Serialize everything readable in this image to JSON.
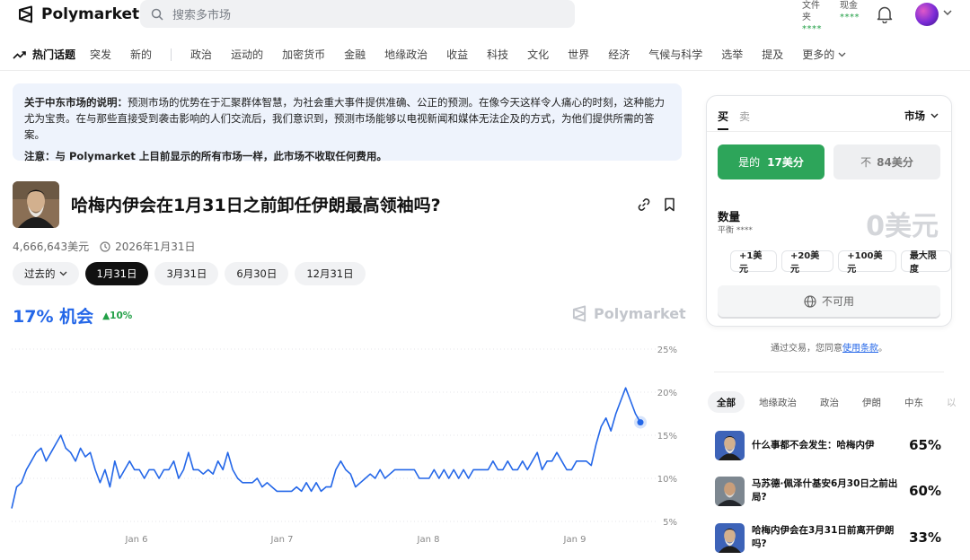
{
  "header": {
    "logo_text": "Polymarket",
    "search_placeholder": "搜索多市场",
    "portfolio_label": "文件夹",
    "portfolio_value": "****",
    "cash_label": "现金",
    "cash_value": "****"
  },
  "nav": {
    "hot": "热门话题",
    "items_a": [
      "突发",
      "新的"
    ],
    "items_b": [
      "政治",
      "运动的",
      "加密货币",
      "金融",
      "地缘政治",
      "收益",
      "科技",
      "文化",
      "世界",
      "经济",
      "气候与科学",
      "选举",
      "提及"
    ],
    "more": "更多的"
  },
  "notice": {
    "line1_bold": "关于中东市场的说明：",
    "line1": "预测市场的优势在于汇聚群体智慧，为社会重大事件提供准确、公正的预测。在像今天这样令人痛心的时刻，这种能力尤为宝贵。在与那些直接受到袭击影响的人们交流后，我们意识到，预测市场能够以电视新闻和媒体无法企及的方式，为他们提供所需的答案。",
    "line2_bold": "注意：",
    "line2": "与 Polymarket 上目前显示的所有市场一样，此市场不收取任何费用。"
  },
  "market": {
    "title": "哈梅内伊会在1月31日之前卸任伊朗最高领袖吗?",
    "volume": "4,666,643美元",
    "end_date": "2026年1月31日",
    "pills": [
      "过去的",
      "1月31日",
      "3月31日",
      "6月30日",
      "12月31日"
    ],
    "chance": "17% 机会",
    "delta": "▲10%",
    "watermark": "Polymarket"
  },
  "trade": {
    "tab_buy": "买",
    "tab_sell": "卖",
    "order_type": "市场",
    "yes_label": "是的",
    "yes_price": "17美分",
    "no_label": "不",
    "no_price": "84美分",
    "qty_label": "数量",
    "balance": "平衡 ****",
    "qty_value": "0美元",
    "quick": [
      "+1美元",
      "+20美元",
      "+100美元",
      "最大限度"
    ],
    "unavailable": "不可用",
    "terms_prefix": "通过交易，您同意",
    "terms_link": "使用条款",
    "terms_suffix": "。"
  },
  "related": {
    "tabs": [
      "全部",
      "地缘政治",
      "政治",
      "伊朗",
      "中东",
      "以"
    ],
    "items": [
      {
        "title": "什么事都不会发生：哈梅内伊",
        "pct": "65%"
      },
      {
        "title": "马苏德·佩泽什基安6月30日之前出局?",
        "pct": "60%"
      },
      {
        "title": "哈梅内伊会在3月31日前离开伊朗吗?",
        "pct": "33%"
      }
    ]
  },
  "colors": {
    "accent": "#2467e8",
    "yes": "#2da55a",
    "up": "#22a047"
  },
  "chart_data": {
    "type": "line",
    "x_ticks": [
      "Jan 6",
      "Jan 7",
      "Jan 8",
      "Jan 9"
    ],
    "y_ticks": [
      "25%",
      "20%",
      "15%",
      "10%",
      "5%"
    ],
    "ylim": [
      5,
      25
    ],
    "series": [
      {
        "values": [
          6.5,
          9,
          9.5,
          11,
          12,
          13,
          13.5,
          12,
          13,
          14,
          15,
          13.5,
          13,
          12,
          13.5,
          12.5,
          13,
          11,
          9.5,
          11,
          9,
          12,
          10,
          11,
          12,
          11,
          11,
          10,
          11,
          11,
          10,
          11,
          11,
          12,
          10,
          11,
          13,
          11,
          11,
          10.5,
          11,
          10.5,
          12,
          11,
          13,
          11,
          10,
          9.5,
          9.5,
          9.5,
          10,
          9,
          9.5,
          9,
          8.5,
          8.5,
          8.5,
          8.5,
          9,
          8.5,
          9.5,
          8.5,
          9.5,
          8.5,
          9,
          9,
          11,
          12,
          11,
          10.5,
          9,
          9.5,
          10,
          10.5,
          10,
          11,
          10,
          10.5,
          11,
          11,
          11,
          11,
          11,
          10,
          10,
          10,
          11,
          10,
          11,
          10,
          11,
          10,
          11,
          10,
          11,
          11,
          11,
          11,
          12,
          11,
          11,
          12,
          11,
          11,
          12,
          11,
          12,
          13,
          11,
          12,
          12,
          13,
          12,
          11,
          11,
          12,
          12,
          12,
          11.5,
          14,
          16,
          17,
          15.5,
          17.5,
          19,
          20.5,
          19,
          17.5,
          16.5
        ]
      }
    ]
  }
}
